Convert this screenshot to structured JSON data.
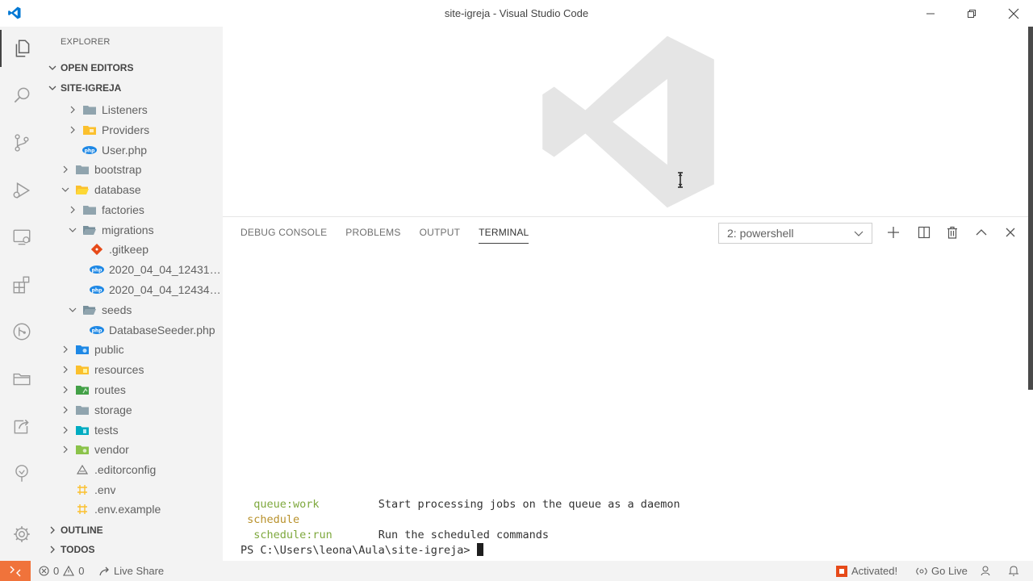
{
  "window": {
    "title": "site-igreja - Visual Studio Code",
    "controls": [
      "minimize",
      "restore",
      "close"
    ]
  },
  "activity_bar": {
    "items": [
      "explorer",
      "search",
      "source-control",
      "run",
      "remote-explorer",
      "extensions",
      "git-graph",
      "folders",
      "live-share",
      "tree-view",
      "settings"
    ]
  },
  "sidebar": {
    "title": "EXPLORER",
    "open_editors": "OPEN EDITORS",
    "project": "SITE-IGREJA",
    "tree": [
      {
        "label": "Listeners",
        "icon": "folder-icon"
      },
      {
        "label": "Providers",
        "icon": "folder-icon"
      },
      {
        "label": "User.php",
        "icon": "php-icon"
      },
      {
        "label": "bootstrap",
        "icon": "folder-icon"
      },
      {
        "label": "database",
        "icon": "folder-open-icon"
      },
      {
        "label": "factories",
        "icon": "folder-icon"
      },
      {
        "label": "migrations",
        "icon": "folder-open-icon"
      },
      {
        "label": ".gitkeep",
        "icon": "git-icon"
      },
      {
        "label": "2020_04_04_124310...",
        "icon": "php-icon"
      },
      {
        "label": "2020_04_04_124342...",
        "icon": "php-icon"
      },
      {
        "label": "seeds",
        "icon": "folder-open-icon"
      },
      {
        "label": "DatabaseSeeder.php",
        "icon": "php-icon"
      },
      {
        "label": "public",
        "icon": "folder-icon"
      },
      {
        "label": "resources",
        "icon": "folder-icon"
      },
      {
        "label": "routes",
        "icon": "folder-icon"
      },
      {
        "label": "storage",
        "icon": "folder-icon"
      },
      {
        "label": "tests",
        "icon": "folder-icon"
      },
      {
        "label": "vendor",
        "icon": "folder-icon"
      },
      {
        "label": ".editorconfig",
        "icon": "editorconfig-icon"
      },
      {
        "label": ".env",
        "icon": "env-icon"
      },
      {
        "label": ".env.example",
        "icon": "env-icon"
      }
    ],
    "outline": "OUTLINE",
    "todos": "TODOS"
  },
  "panel": {
    "tabs": [
      "DEBUG CONSOLE",
      "PROBLEMS",
      "OUTPUT",
      "TERMINAL"
    ],
    "active_tab": "TERMINAL",
    "terminal_select": "2: powershell",
    "terminal": {
      "line1_cmd": "  queue:work",
      "line1_desc": "Start processing jobs on the queue as a daemon",
      "line2": " schedule",
      "line3_cmd": "  schedule:run",
      "line3_desc": "Run the scheduled commands",
      "prompt": "PS C:\\Users\\leona\\Aula\\site-igreja> "
    }
  },
  "statusbar": {
    "errors": "0",
    "warnings": "0",
    "live_share": "Live Share",
    "activated": "Activated!",
    "go_live": "Go Live"
  },
  "colors": {
    "accent_remote": "#f0733b",
    "folder": "#90a4ae",
    "php": "#1e88e5"
  }
}
